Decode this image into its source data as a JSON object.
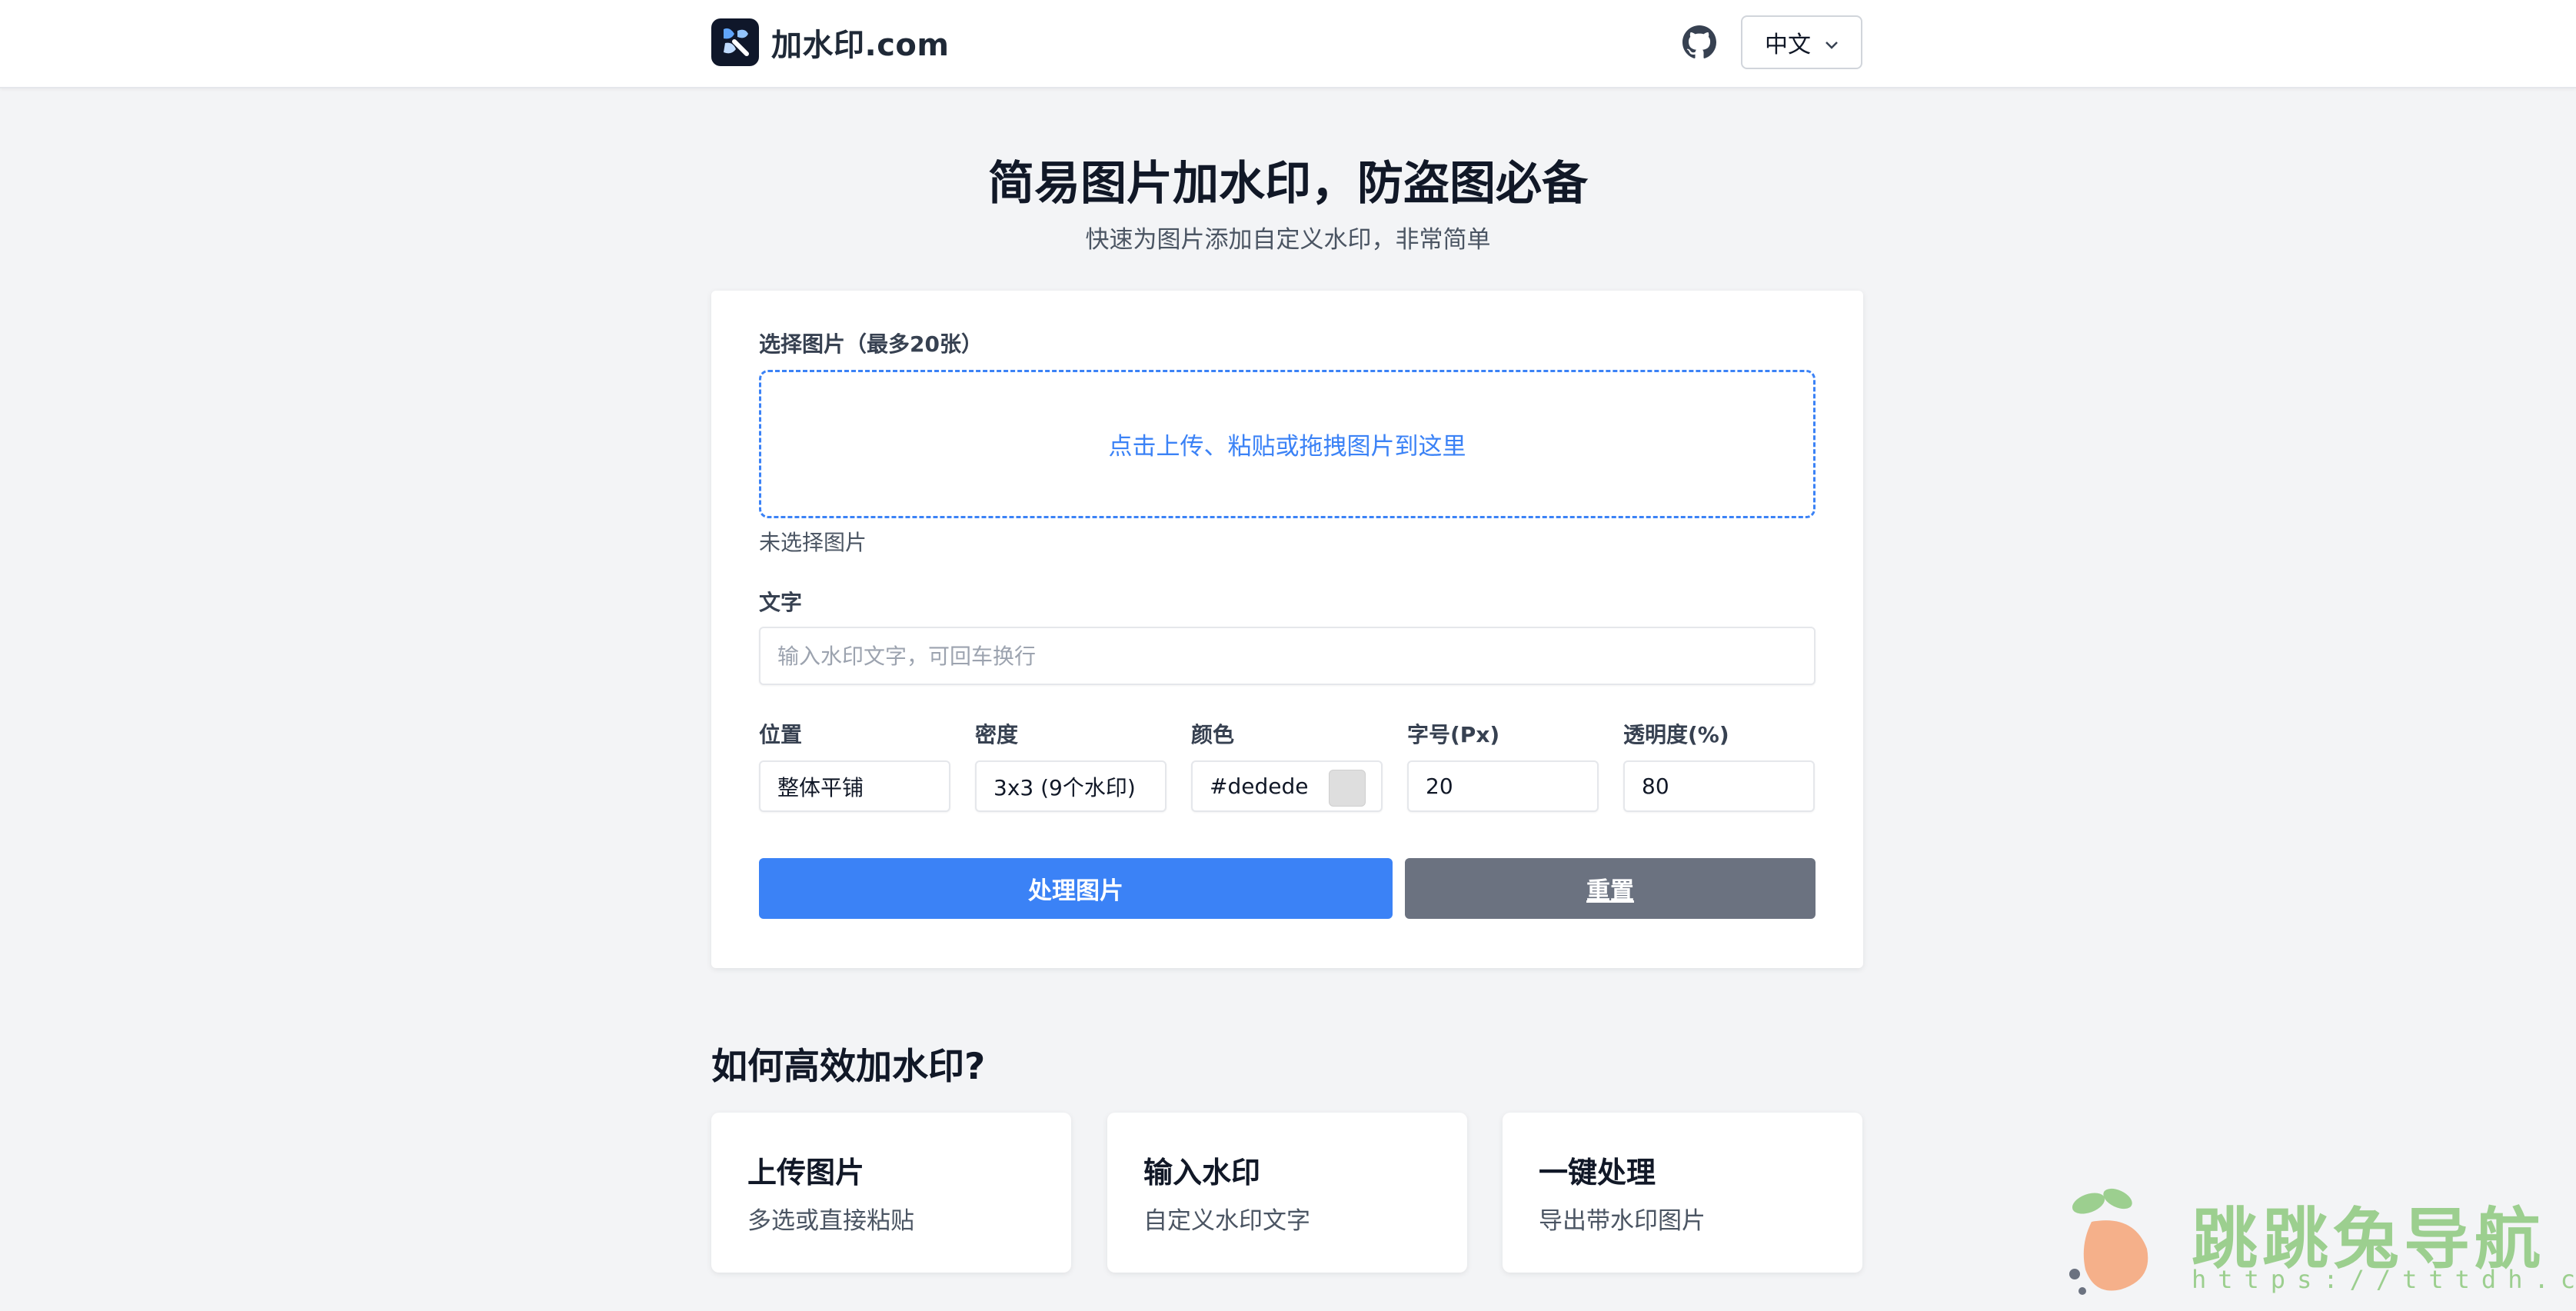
{
  "header": {
    "site_name": "加水印.com",
    "logo_icon": "water-drop-logo-icon",
    "github_icon": "github-icon",
    "language": "中文",
    "language_icon": "chevron-down-icon"
  },
  "hero": {
    "title": "简易图片加水印，防盗图必备",
    "subtitle": "快速为图片添加自定义水印，非常简单"
  },
  "form": {
    "upload_label": "选择图片（最多20张）",
    "dropzone_text": "点击上传、粘贴或拖拽图片到这里",
    "no_file_text": "未选择图片",
    "text_label": "文字",
    "text_placeholder": "输入水印文字，可回车换行",
    "text_value": "",
    "position_label": "位置",
    "position_value": "整体平铺",
    "density_label": "密度",
    "density_value": "3x3 (9个水印)",
    "color_label": "颜色",
    "color_value": "#dedede",
    "color_swatch": "#dedede",
    "fontsize_label": "字号(Px)",
    "fontsize_value": "20",
    "opacity_label": "透明度(%)",
    "opacity_value": "80",
    "process_button": "处理图片",
    "reset_button": "重置"
  },
  "howto": {
    "title": "如何高效加水印?",
    "steps": [
      {
        "title": "上传图片",
        "desc": "多选或直接粘贴"
      },
      {
        "title": "输入水印",
        "desc": "自定义水印文字"
      },
      {
        "title": "一键处理",
        "desc": "导出带水印图片"
      }
    ]
  },
  "overlay": {
    "watermark_text": "跳跳兔导航",
    "watermark_url": "https://tttdh.com",
    "watermark_icon": "rabbit-logo-icon",
    "watermark_color": "#9ccf8f"
  },
  "colors": {
    "primary": "#3b82f6",
    "secondary": "#6b7280",
    "background": "#f3f4f6"
  }
}
